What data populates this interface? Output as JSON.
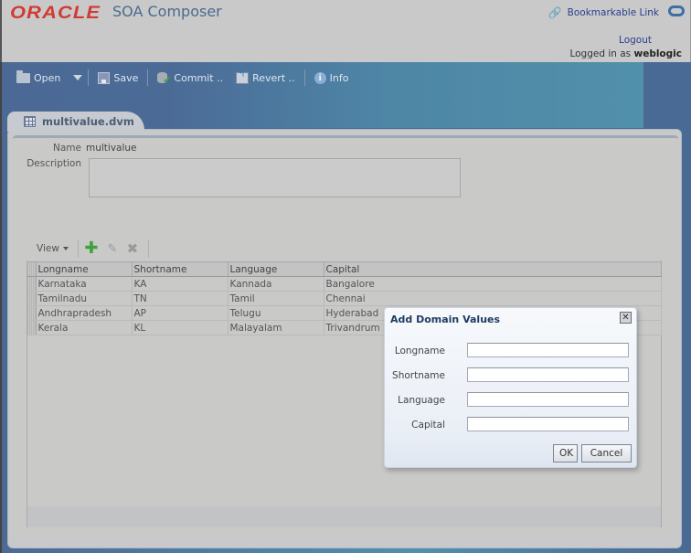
{
  "header": {
    "brand": "ORACLE",
    "app_title": "SOA Composer",
    "bookmark_link": "Bookmarkable Link",
    "logout": "Logout",
    "logged_in_prefix": "Logged in as",
    "username": "weblogic"
  },
  "toolbar": {
    "open": "Open",
    "save": "Save",
    "commit": "Commit ..",
    "revert": "Revert ..",
    "info": "Info"
  },
  "tab": {
    "label": "multivalue.dvm"
  },
  "form": {
    "name_label": "Name",
    "name_value": "multivalue",
    "description_label": "Description",
    "description_value": ""
  },
  "table_toolbar": {
    "view": "View"
  },
  "table": {
    "columns": [
      "Longname",
      "Shortname",
      "Language",
      "Capital"
    ],
    "rows": [
      [
        "Karnataka",
        "KA",
        "Kannada",
        "Bangalore"
      ],
      [
        "Tamilnadu",
        "TN",
        "Tamil",
        "Chennai"
      ],
      [
        "Andhrapradesh",
        "AP",
        "Telugu",
        "Hyderabad"
      ],
      [
        "Kerala",
        "KL",
        "Malayalam",
        "Trivandrum"
      ]
    ]
  },
  "dialog": {
    "title": "Add Domain Values",
    "fields": [
      {
        "label": "Longname",
        "value": ""
      },
      {
        "label": "Shortname",
        "value": ""
      },
      {
        "label": "Language",
        "value": ""
      },
      {
        "label": "Capital",
        "value": ""
      }
    ],
    "ok": "OK",
    "cancel": "Cancel"
  },
  "colors": {
    "brand_red": "#d13a32",
    "header_bg": "#c9c9c9",
    "band_blue": "#4a6a93",
    "dialog_title": "#1e3c63"
  }
}
